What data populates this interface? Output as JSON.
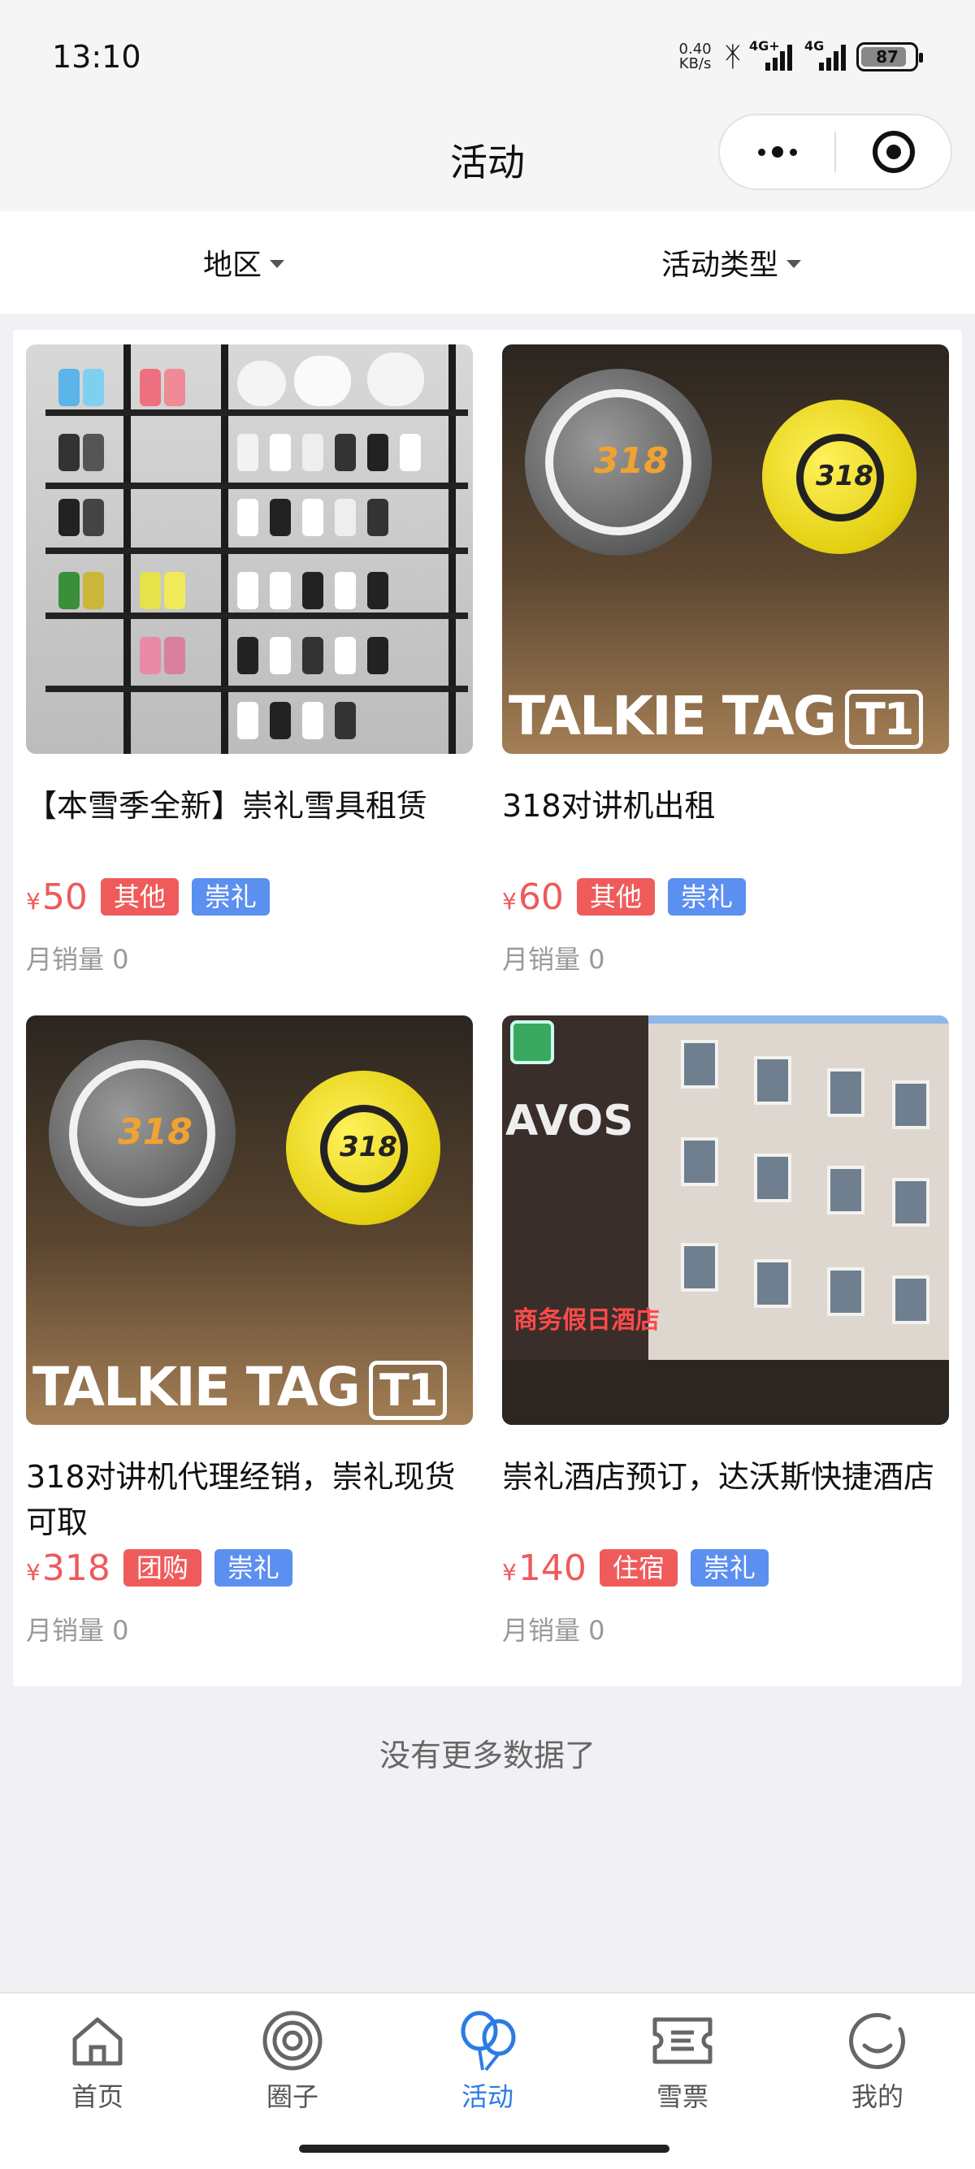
{
  "status_bar": {
    "time": "13:10",
    "net_speed_value": "0.40",
    "net_speed_unit": "KB/s",
    "signal1_label": "4G+",
    "signal2_label": "4G",
    "battery": "87"
  },
  "header": {
    "title": "活动"
  },
  "filters": [
    {
      "label": "地区"
    },
    {
      "label": "活动类型"
    }
  ],
  "products": [
    {
      "title": "【本雪季全新】崇礼雪具租赁",
      "price_symbol": "¥",
      "price": "50",
      "tag1": "其他",
      "tag2": "崇礼",
      "sales": "月销量 0"
    },
    {
      "title": "318对讲机出租",
      "price_symbol": "¥",
      "price": "60",
      "tag1": "其他",
      "tag2": "崇礼",
      "sales": "月销量 0",
      "image_text": "TALKIE TAG",
      "image_badge": "T1"
    },
    {
      "title": "318对讲机代理经销，崇礼现货可取",
      "price_symbol": "¥",
      "price": "318",
      "tag1": "团购",
      "tag2": "崇礼",
      "sales": "月销量 0",
      "image_text": "TALKIE TAG",
      "image_badge": "T1"
    },
    {
      "title": "崇礼酒店预订，达沃斯快捷酒店",
      "price_symbol": "¥",
      "price": "140",
      "tag1": "住宿",
      "tag2": "崇礼",
      "sales": "月销量 0",
      "image_text": "AVOS",
      "image_sign": "商务假日酒店"
    }
  ],
  "footer_text": "没有更多数据了",
  "tabbar": [
    {
      "label": "首页",
      "icon": "home-icon"
    },
    {
      "label": "圈子",
      "icon": "circle-icon"
    },
    {
      "label": "活动",
      "icon": "balloon-icon"
    },
    {
      "label": "雪票",
      "icon": "ticket-icon"
    },
    {
      "label": "我的",
      "icon": "profile-icon"
    }
  ],
  "colors": {
    "price": "#ee5a5a",
    "tag_red": "#ef5b5b",
    "tag_blue": "#5b8ff0",
    "tab_active": "#2c7be5"
  }
}
